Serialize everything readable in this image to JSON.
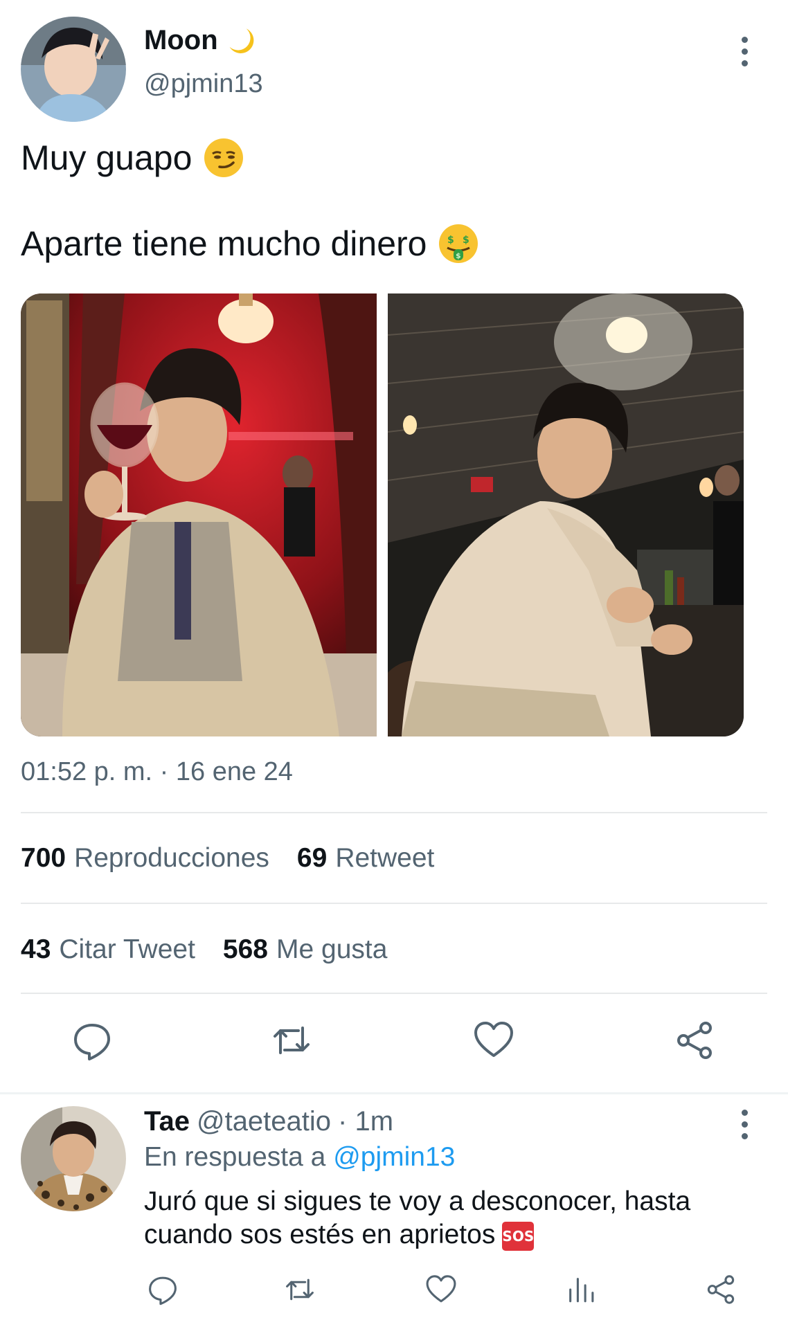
{
  "tweet": {
    "author_name": "Moon",
    "author_emoji": "crescent-moon",
    "author_handle": "@pjmin13",
    "text_line_1": "Muy guapo",
    "text_line_2": "Aparte tiene mucho dinero",
    "emoji_1": "smirking-face",
    "emoji_2": "money-mouth-face",
    "photo_count": 2,
    "timestamp": "01:52 p. m. · 16 ene 24"
  },
  "stats": {
    "views_count": "700",
    "views_label": "Reproducciones",
    "retweets_count": "69",
    "retweets_label": "Retweet",
    "quotes_count": "43",
    "quotes_label": "Citar Tweet",
    "likes_count": "568",
    "likes_label": "Me gusta"
  },
  "actions": [
    "reply-icon",
    "retweet-icon",
    "like-icon",
    "share-icon"
  ],
  "reply": {
    "author_name": "Tae",
    "author_handle": "@taeteatio",
    "time": "· 1m",
    "in_reply_prefix": "En respuesta a",
    "in_reply_mention": "@pjmin13",
    "text": "Juró que si sigues te voy a desconocer, hasta cuando sos estés en aprietos",
    "emoji_label": "SOS",
    "actions": [
      "reply-icon",
      "retweet-icon",
      "like-icon",
      "analytics-icon",
      "share-icon"
    ]
  },
  "colors": {
    "text_primary": "#0f1419",
    "text_secondary": "#536471",
    "link": "#1d9bf0",
    "divider": "#e7e9ea"
  }
}
